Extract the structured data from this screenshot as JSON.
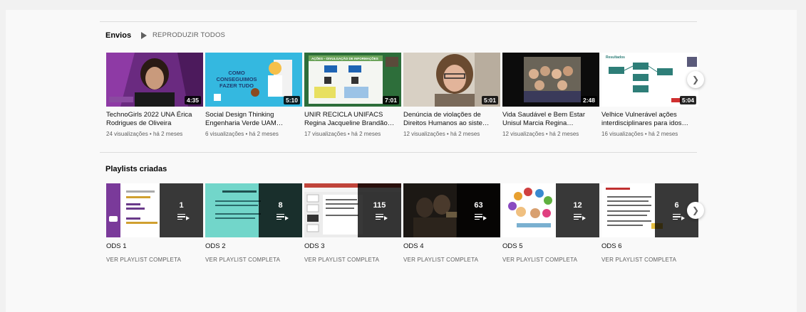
{
  "uploads": {
    "title": "Envios",
    "play_all": "REPRODUZIR TODOS",
    "videos": [
      {
        "title": "TechnoGirls 2022 UNA Érica Rodrigues de Oliveira",
        "views": "24 visualizações",
        "age": "há 2 meses",
        "duration": "4:35"
      },
      {
        "title": "Social Design Thinking Engenharia Verde UAM…",
        "views": "6 visualizações",
        "age": "há 2 meses",
        "duration": "5:10"
      },
      {
        "title": "UNIR RECICLA UNIFACS Regina Jacqueline Brandão…",
        "views": "17 visualizações",
        "age": "há 2 meses",
        "duration": "7:01"
      },
      {
        "title": "Denúncia de violações de Direitos Humanos ao siste…",
        "views": "12 visualizações",
        "age": "há 2 meses",
        "duration": "5:01"
      },
      {
        "title": "Vida Saudável e Bem Estar Unisul Marcia Regina…",
        "views": "12 visualizações",
        "age": "há 2 meses",
        "duration": "2:48"
      },
      {
        "title": "Velhice Vulnerável ações interdisciplinares para idos…",
        "views": "16 visualizações",
        "age": "há 2 meses",
        "duration": "5:04"
      }
    ]
  },
  "playlists": {
    "title": "Playlists criadas",
    "items": [
      {
        "title": "ODS 1",
        "count": "1",
        "link": "VER PLAYLIST COMPLETA"
      },
      {
        "title": "ODS 2",
        "count": "8",
        "link": "VER PLAYLIST COMPLETA"
      },
      {
        "title": "ODS 3",
        "count": "115",
        "link": "VER PLAYLIST COMPLETA"
      },
      {
        "title": "ODS 4",
        "count": "63",
        "link": "VER PLAYLIST COMPLETA"
      },
      {
        "title": "ODS 5",
        "count": "12",
        "link": "VER PLAYLIST COMPLETA"
      },
      {
        "title": "ODS 6",
        "count": "6",
        "link": "VER PLAYLIST COMPLETA"
      }
    ]
  },
  "thumbnail_text": {
    "v2": "COMO CONSEGUIMOS FAZER TUDO",
    "v3": "AÇÕES – DIVULGAÇÃO DE INFORMAÇÕES",
    "v6": "Resultados"
  },
  "colors": {
    "accent_purple": "#7b2e8e",
    "meta_gray": "#606060"
  },
  "icons": {
    "next": "chevron-right-icon",
    "play": "play-icon",
    "playlist": "playlist-icon"
  }
}
